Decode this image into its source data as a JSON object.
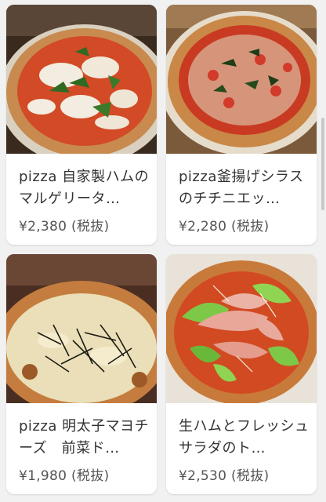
{
  "products": [
    {
      "name": "pizza 自家製ハムのマルゲリータ…",
      "price": "¥2,380 (税抜)",
      "image": "margherita-pizza-photo"
    },
    {
      "name": "pizza釜揚げシラスのチチニエッ…",
      "price": "¥2,280 (税抜)",
      "image": "shirasu-pizza-photo"
    },
    {
      "name": "pizza 明太子マヨチーズ　前菜ド…",
      "price": "¥1,980 (税抜)",
      "image": "mentaiko-pizza-photo"
    },
    {
      "name": "生ハムとフレッシュサラダのト…",
      "price": "¥2,530 (税抜)",
      "image": "prosciutto-salad-pizza-photo"
    }
  ]
}
